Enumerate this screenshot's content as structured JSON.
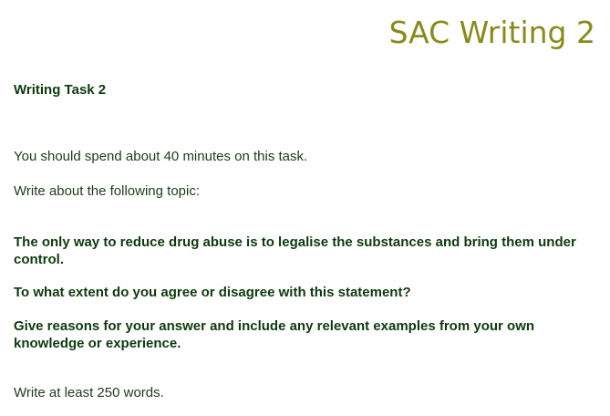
{
  "title": "SAC Writing 2",
  "heading": "Writing Task 2",
  "instructions": {
    "time": "You should spend about 40 minutes on this task.",
    "intro": "Write about the following topic:",
    "statement": "The only way to reduce drug abuse is to legalise the substances and bring them under control.",
    "question": "To what extent do you agree or disagree with this statement?",
    "guidance": "Give reasons for your answer and include any relevant examples from your own knowledge or experience.",
    "word_count": "Write at least 250 words."
  },
  "colors": {
    "title": "#8a8a1a",
    "text": "#0e3a0e"
  }
}
